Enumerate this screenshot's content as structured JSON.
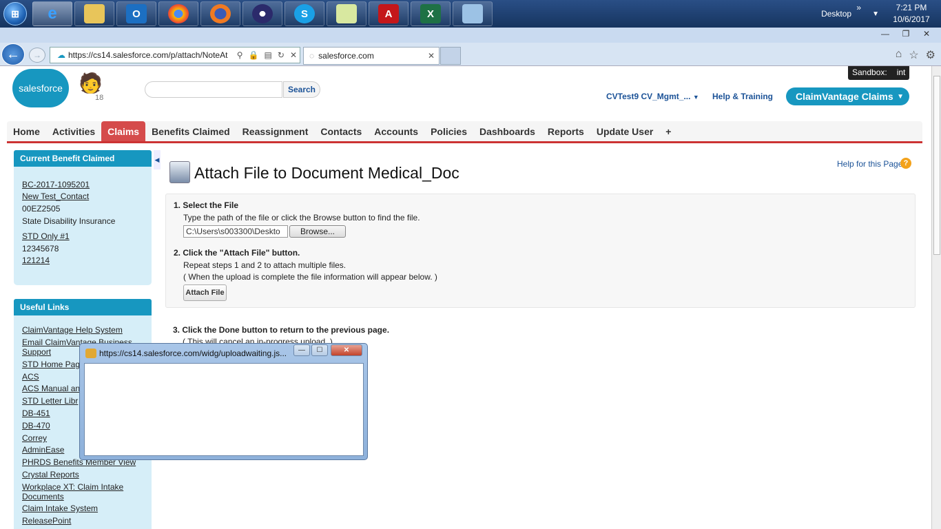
{
  "taskbar": {
    "start_label": "⊞",
    "desktop_label": "Desktop",
    "time": "7:21 PM",
    "date": "10/6/2017",
    "expand": "»"
  },
  "browser": {
    "url": "https://cs14.salesforce.com/p/attach/NoteAt",
    "tab_label": "salesforce.com"
  },
  "header": {
    "logo_text": "salesforce",
    "mascot_count": "18",
    "search_button": "Search",
    "user_menu": "CVTest9 CV_Mgmt_...",
    "help_training": "Help & Training",
    "app_menu": "ClaimVantage Claims",
    "sandbox_label": "Sandbox:",
    "sandbox_value": "int"
  },
  "nav": {
    "tabs": [
      "Home",
      "Activities",
      "Claims",
      "Benefits Claimed",
      "Reassignment",
      "Contacts",
      "Accounts",
      "Policies",
      "Dashboards",
      "Reports",
      "Update User",
      "+"
    ]
  },
  "sidebar": {
    "current_title": "Current Benefit Claimed",
    "current_items": [
      "BC-2017-1095201",
      "New Test_Contact",
      "00EZ2505",
      "State Disability Insurance",
      "STD Only #1",
      "12345678",
      "121214"
    ],
    "useful_title": "Useful Links",
    "useful_items": [
      "ClaimVantage Help System",
      "Email ClaimVantage Business",
      "Support",
      "STD Home Pag",
      "ACS",
      "ACS Manual an",
      "STD Letter Libr",
      "DB-451",
      "DB-470",
      "Correy",
      "AdminEase",
      "PHRDS Benefits Member View",
      "Crystal Reports",
      "Workplace XT: Claim Intake",
      "Documents",
      "Claim Intake System",
      "ReleasePoint"
    ]
  },
  "main": {
    "title": "Attach File to Document Medical_Doc",
    "help_page": "Help for this Page",
    "step1_title": "1. Select the File",
    "step1_text": "Type the path of the file or click the Browse button to find the file.",
    "file_value": "C:\\Users\\s003300\\Deskto",
    "browse_label": "Browse...",
    "step2_title": "2. Click the \"Attach File\" button.",
    "step2_text1": "Repeat steps 1 and 2 to attach multiple files.",
    "step2_text2": "( When the upload is complete the file information will appear below. )",
    "attach_label": "Attach File",
    "step3_title": "3. Click the Done button to return to the previous page.",
    "step3_text": "( This will cancel an in-progress upload. )"
  },
  "popup": {
    "title": "https://cs14.salesforce.com/widg/uploadwaiting.js...",
    "close_glyph": "✕"
  }
}
